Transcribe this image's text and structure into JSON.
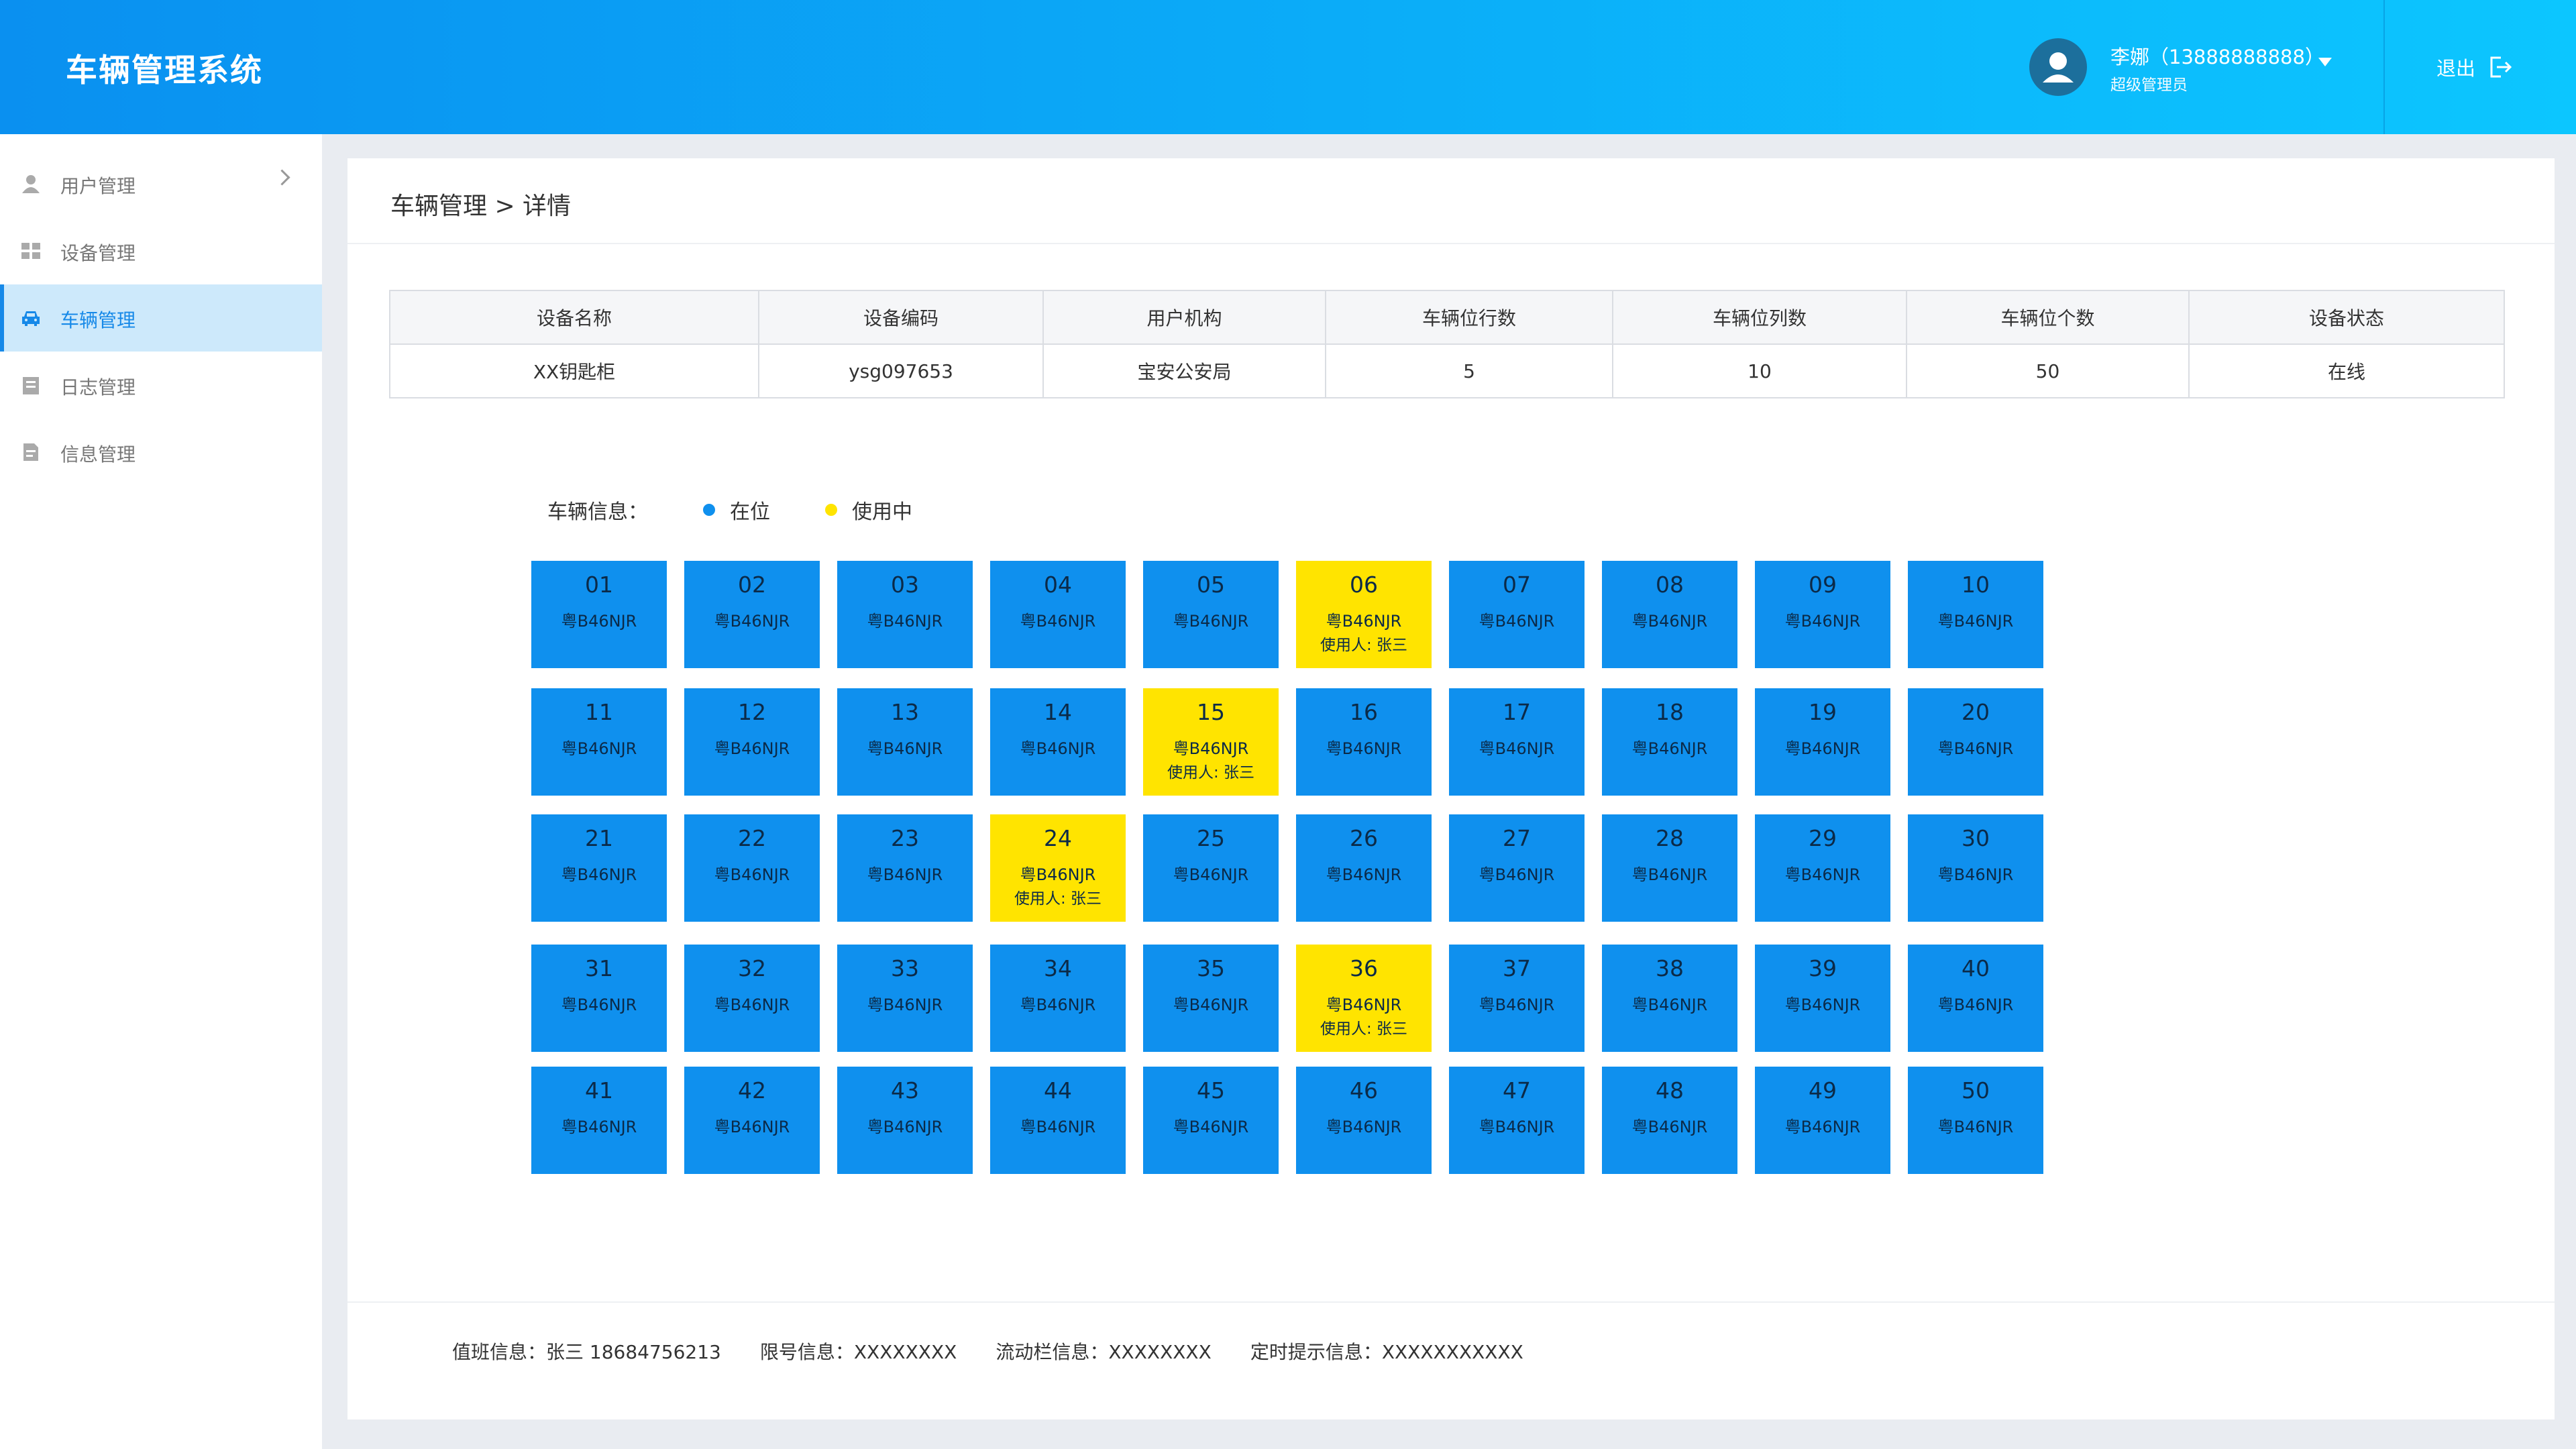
{
  "header": {
    "title": "车辆管理系统",
    "user_name": "李娜（13888888888）",
    "user_role": "超级管理员",
    "logout_label": "退出"
  },
  "sidebar": {
    "items": [
      {
        "label": "用户管理",
        "icon": "user-icon",
        "active": false,
        "has_chevron": true
      },
      {
        "label": "设备管理",
        "icon": "grid-icon",
        "active": false
      },
      {
        "label": "车辆管理",
        "icon": "car-icon",
        "active": true
      },
      {
        "label": "日志管理",
        "icon": "log-icon",
        "active": false
      },
      {
        "label": "信息管理",
        "icon": "info-doc-icon",
        "active": false
      }
    ]
  },
  "breadcrumb": "车辆管理 > 详情",
  "device_table": {
    "headers": [
      "设备名称",
      "设备编码",
      "用户机构",
      "车辆位行数",
      "车辆位列数",
      "车辆位个数",
      "设备状态"
    ],
    "row": [
      "XX钥匙柜",
      "ysg097653",
      "宝安公安局",
      "5",
      "10",
      "50",
      "在线"
    ]
  },
  "legend": {
    "title": "车辆信息：",
    "items": [
      {
        "label": "在位",
        "color": "#0f90ee"
      },
      {
        "label": "使用中",
        "color": "#ffe400"
      }
    ]
  },
  "colors": {
    "available": "#0f90ee",
    "in_use": "#ffe400",
    "accent": "#1689e8"
  },
  "slots": [
    {
      "num": "01",
      "plate": "粤B46NJR"
    },
    {
      "num": "02",
      "plate": "粤B46NJR"
    },
    {
      "num": "03",
      "plate": "粤B46NJR"
    },
    {
      "num": "04",
      "plate": "粤B46NJR"
    },
    {
      "num": "05",
      "plate": "粤B46NJR"
    },
    {
      "num": "06",
      "plate": "粤B46NJR",
      "user": "使用人: 张三"
    },
    {
      "num": "07",
      "plate": "粤B46NJR"
    },
    {
      "num": "08",
      "plate": "粤B46NJR"
    },
    {
      "num": "09",
      "plate": "粤B46NJR"
    },
    {
      "num": "10",
      "plate": "粤B46NJR"
    },
    {
      "num": "11",
      "plate": "粤B46NJR"
    },
    {
      "num": "12",
      "plate": "粤B46NJR"
    },
    {
      "num": "13",
      "plate": "粤B46NJR"
    },
    {
      "num": "14",
      "plate": "粤B46NJR"
    },
    {
      "num": "15",
      "plate": "粤B46NJR",
      "user": "使用人: 张三"
    },
    {
      "num": "16",
      "plate": "粤B46NJR"
    },
    {
      "num": "17",
      "plate": "粤B46NJR"
    },
    {
      "num": "18",
      "plate": "粤B46NJR"
    },
    {
      "num": "19",
      "plate": "粤B46NJR"
    },
    {
      "num": "20",
      "plate": "粤B46NJR"
    },
    {
      "num": "21",
      "plate": "粤B46NJR"
    },
    {
      "num": "22",
      "plate": "粤B46NJR"
    },
    {
      "num": "23",
      "plate": "粤B46NJR"
    },
    {
      "num": "24",
      "plate": "粤B46NJR",
      "user": "使用人: 张三"
    },
    {
      "num": "25",
      "plate": "粤B46NJR"
    },
    {
      "num": "26",
      "plate": "粤B46NJR"
    },
    {
      "num": "27",
      "plate": "粤B46NJR"
    },
    {
      "num": "28",
      "plate": "粤B46NJR"
    },
    {
      "num": "29",
      "plate": "粤B46NJR"
    },
    {
      "num": "30",
      "plate": "粤B46NJR"
    },
    {
      "num": "31",
      "plate": "粤B46NJR"
    },
    {
      "num": "32",
      "plate": "粤B46NJR"
    },
    {
      "num": "33",
      "plate": "粤B46NJR"
    },
    {
      "num": "34",
      "plate": "粤B46NJR"
    },
    {
      "num": "35",
      "plate": "粤B46NJR"
    },
    {
      "num": "36",
      "plate": "粤B46NJR",
      "user": "使用人: 张三"
    },
    {
      "num": "37",
      "plate": "粤B46NJR"
    },
    {
      "num": "38",
      "plate": "粤B46NJR"
    },
    {
      "num": "39",
      "plate": "粤B46NJR"
    },
    {
      "num": "40",
      "plate": "粤B46NJR"
    },
    {
      "num": "41",
      "plate": "粤B46NJR"
    },
    {
      "num": "42",
      "plate": "粤B46NJR"
    },
    {
      "num": "43",
      "plate": "粤B46NJR"
    },
    {
      "num": "44",
      "plate": "粤B46NJR"
    },
    {
      "num": "45",
      "plate": "粤B46NJR"
    },
    {
      "num": "46",
      "plate": "粤B46NJR"
    },
    {
      "num": "47",
      "plate": "粤B46NJR"
    },
    {
      "num": "48",
      "plate": "粤B46NJR"
    },
    {
      "num": "49",
      "plate": "粤B46NJR"
    },
    {
      "num": "50",
      "plate": "粤B46NJR"
    }
  ],
  "footer": {
    "duty": "值班信息：张三 18684756213",
    "restriction": "限号信息：XXXXXXXX",
    "ticker": "流动栏信息：XXXXXXXX",
    "reminder": "定时提示信息：XXXXXXXXXXX"
  }
}
